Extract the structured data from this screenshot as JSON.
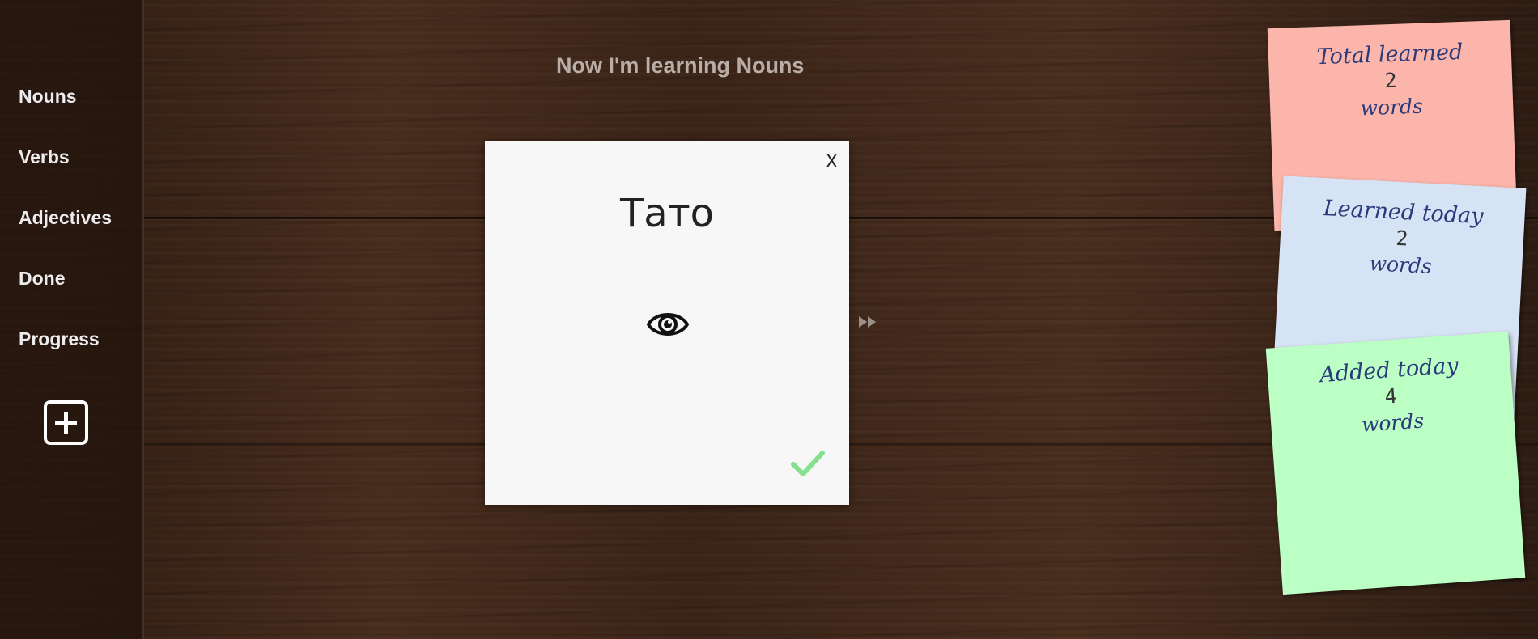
{
  "sidebar": {
    "items": [
      {
        "label": "Nouns"
      },
      {
        "label": "Verbs"
      },
      {
        "label": "Adjectives"
      },
      {
        "label": "Done"
      },
      {
        "label": "Progress"
      }
    ],
    "add_icon": "plus-square-icon"
  },
  "header": {
    "title": "Now I'm learning Nouns"
  },
  "card": {
    "close_label": "X",
    "word": "Тато",
    "reveal_icon": "eye-icon",
    "confirm_icon": "checkmark-icon",
    "confirm_color": "#86e08f"
  },
  "navigation": {
    "skip_icon": "fast-forward-icon"
  },
  "stats": {
    "total_learned": {
      "label": "Total learned",
      "count": "2",
      "unit": "words",
      "color": "#fbb5ab"
    },
    "learned_today": {
      "label": "Learned today",
      "count": "2",
      "unit": "words",
      "color": "#d6e3f5"
    },
    "added_today": {
      "label": "Added today",
      "count": "4",
      "unit": "words",
      "color": "#bbffc5"
    }
  }
}
